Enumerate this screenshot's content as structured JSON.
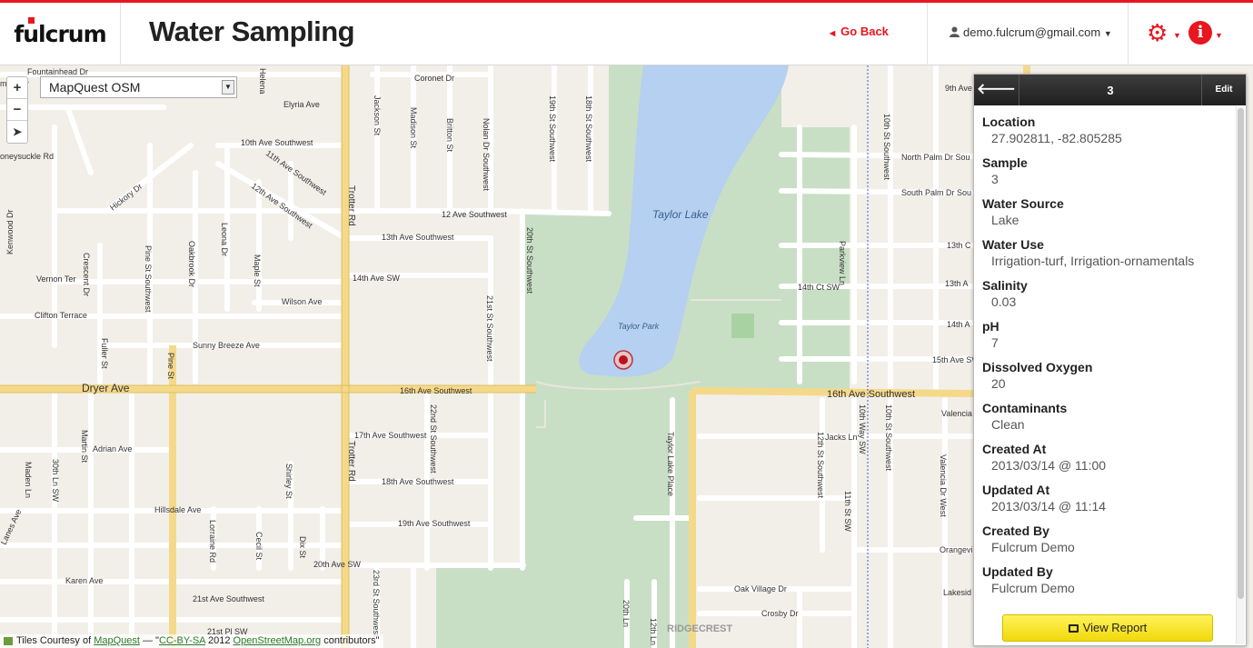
{
  "app": {
    "logo": "fulcrum",
    "title": "Water Sampling",
    "go_back": "Go Back",
    "user": "demo.fulcrum@gmail.com"
  },
  "map": {
    "layer": "MapQuest OSM",
    "zoom_in": "+",
    "zoom_out": "−",
    "attribution": {
      "prefix": "Tiles Courtesy of ",
      "mapquest": "MapQuest",
      "middle": " — \"",
      "license": "CC-BY-SA",
      "year": " 2012 ",
      "osm": "OpenStreetMap.org",
      "suffix": " contributors\""
    },
    "labels": {
      "taylor_lake": "Taylor Lake",
      "taylor_park": "Taylor Park",
      "ridgecrest": "RIDGECREST",
      "dryer_ave": "Dryer Ave",
      "sixteenth_sw": "16th Ave Southwest",
      "sixteenth_sw_e": "16th Ave Southwest",
      "trotter_rd": "Trotter Rd",
      "trotter_rd_s": "Trotter Rd",
      "twelve_ave_sw": "12 Ave Southwest",
      "thirteenth_ave_sw": "13th Ave Southwest",
      "fourteenth_ave_sw": "14th Ave SW",
      "wilson_ave": "Wilson Ave",
      "sunny_breeze": "Sunny Breeze Ave",
      "seventeenth": "17th Ave Southwest",
      "eighteenth": "18th Ave Southwest",
      "nineteenth": "19th Ave Southwest",
      "twentieth": "20th Ave SW",
      "twentyfirst": "21st Ave Southwest",
      "adrian_ave": "Adrian Ave",
      "hillsdale": "Hillsdale Ave",
      "karen_ave": "Karen Ave",
      "clifton": "Clifton Terrace",
      "vernon_ter": "Vernon Ter",
      "elyria": "Elyria Ave",
      "coronet": "Coronet Dr",
      "fountainhead": "Fountainhead Dr",
      "tenth_ave_sw": "10th Ave Southwest",
      "eleventh_ave_sw": "11th Ave Southwest",
      "twelfth_ave_sw": "12th Ave Southwest",
      "hickory": "Hickory Dr",
      "honeysuckle": "oneysuckle Rd",
      "primary": "mary Dr",
      "ninth_ave": "9th Ave",
      "north_palm": "North Palm Dr Sou",
      "south_palm": "South Palm Dr Sou",
      "fourteenth_ct": "14th Ct SW",
      "jacks_ln": "Jacks Ln",
      "oak_village": "Oak Village Dr",
      "crosby": "Crosby Dr",
      "thirteenth_c": "13th C",
      "thirteenth_a": "13th A",
      "fourteenth_a": "14th A",
      "fifteenth_ave": "15th Ave SW",
      "valencia": "Valencia Dr",
      "valencia_w": "Valencia Dr West",
      "orange": "Orangevi",
      "lakeside": "Lakesid",
      "twentieth_st_sw": "20th St Southwest",
      "twentyfirst_st_sw": "21st St Southwest",
      "twentysecond": "22nd St Southwest",
      "tenth_st_n": "10th St Southwest",
      "tenth_way": "10th Way SW",
      "eleventh_st": "11th St SW",
      "twelfth_st": "12th St Southwest",
      "tenth_st_s": "10th St Southwest",
      "taylor_lake_place": "Taylor Lake Place",
      "parkview": "Parkview Ln",
      "nineteenth_st": "19th St Southwest",
      "eighteenth_st": "18th St Southwest",
      "pine_st": "Pine St Southwest",
      "pine_st2": "Pine St",
      "oakbrook": "Oakbrook Dr",
      "leona": "Leona Dr",
      "maple": "Maple St",
      "crescent": "Crescent Dr",
      "kenwood": "Kenwood Dr",
      "fuller": "Fuller St",
      "martin": "Martin St",
      "maden": "Maden Ln",
      "thirtieth": "30th Ln SW",
      "shirley": "Shirley St",
      "lorraine": "Lorraine Rd",
      "cecil": "Cecil St",
      "dix": "Dix St",
      "twentythird": "23rd St Southwest",
      "jackson": "Jackson St",
      "madison": "Madison St",
      "britton": "Britton St",
      "nolan": "Nolan Dr Southwest",
      "twelfth_sw": "12th St Southwest",
      "twentieth_n": "20th Ln",
      "twentyfirst_pl": "21st Pl SW",
      "twelfth_n": "12th Ln",
      "edge_hy": "Helena",
      "edge_left": "Lanes Ave"
    }
  },
  "panel": {
    "title": "3",
    "edit": "Edit",
    "fields": [
      {
        "label": "Location",
        "value": "27.902811, -82.805285"
      },
      {
        "label": "Sample",
        "value": "3"
      },
      {
        "label": "Water Source",
        "value": "Lake"
      },
      {
        "label": "Water Use",
        "value": "Irrigation-turf, Irrigation-ornamentals"
      },
      {
        "label": "Salinity",
        "value": "0.03"
      },
      {
        "label": "pH",
        "value": "7"
      },
      {
        "label": "Dissolved Oxygen",
        "value": "20"
      },
      {
        "label": "Contaminants",
        "value": "Clean"
      },
      {
        "label": "Created At",
        "value": "2013/03/14 @ 11:00"
      },
      {
        "label": "Updated At",
        "value": "2013/03/14 @ 11:14"
      },
      {
        "label": "Created By",
        "value": "Fulcrum Demo"
      },
      {
        "label": "Updated By",
        "value": "Fulcrum Demo"
      }
    ],
    "view_report": "View Report"
  },
  "colors": {
    "accent": "#e8161e",
    "lake": "#b5d0f0",
    "park": "#c8dfc5",
    "major_road": "#f5d98a",
    "land": "#f2efe9"
  },
  "icons": {
    "settings": "gear-icon",
    "info": "info-icon",
    "back": "arrow-left-icon",
    "print": "print-icon",
    "user": "user-icon"
  }
}
